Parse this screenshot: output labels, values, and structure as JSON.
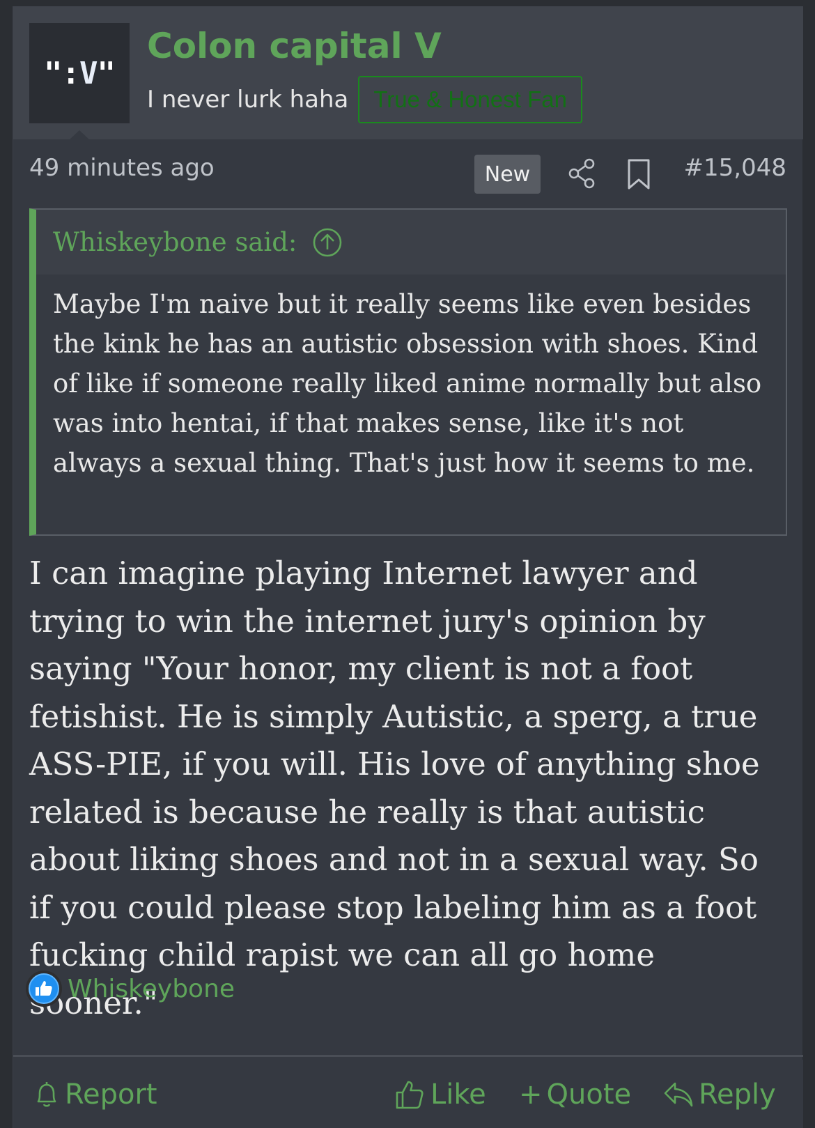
{
  "post": {
    "author": {
      "avatar_text": {
        "quote1": "\"",
        "colon": ":",
        "v": "V",
        "quote2": "\""
      },
      "username": "Colon capital V",
      "user_title": "I never lurk haha",
      "banner": "True & Honest Fan"
    },
    "meta": {
      "timestamp": "49 minutes ago",
      "new_badge": "New",
      "post_number": "#15,048"
    },
    "quote": {
      "author": "Whiskeybone said:",
      "text": "Maybe I'm naive but it really seems like even besides the kink he has an autistic obsession with shoes. Kind of like if someone really liked anime normally but also was into hentai, if that makes sense, like it's not always a sexual thing. That's just how it seems to me."
    },
    "message": "I can imagine playing Internet lawyer and trying to win the internet jury's opinion by saying \"Your honor, my client is not a foot fetishist. He is simply Autistic, a sperg, a true ASS-PIE, if you will. His love of anything shoe related is because he really is that autistic about liking shoes and not in a sexual way. So if you could please stop labeling him as a foot fucking child rapist we can all go home sooner.\"",
    "reactions": {
      "users": "Whiskeybone",
      "icon": "like-reaction-icon"
    },
    "actions": {
      "report": "Report",
      "like": "Like",
      "quote": "Quote",
      "quote_prefix": "+",
      "reply": "Reply"
    }
  },
  "colors": {
    "accent_green": "#5fa55a",
    "banner_green": "#127015",
    "background": "#2b2e33",
    "post_bg": "#353941",
    "header_bg": "#40444c"
  }
}
